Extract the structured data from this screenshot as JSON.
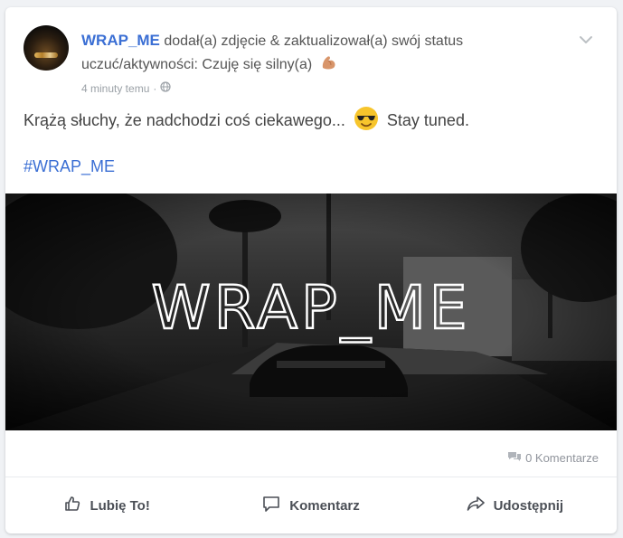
{
  "post": {
    "author": "WRAP_ME",
    "action_text": "dodał(a) zdjęcie & zaktualizował(a) swój status uczuć/aktywności: Czuję się silny(a)",
    "time": "4 minuty temu",
    "meta_separator": "·",
    "text_before": "Krążą słuchy, że nadchodzi coś ciekawego...",
    "text_after": "Stay tuned.",
    "hashtag": "#WRAP_ME",
    "image_text": "WRAP_ME",
    "comments": "0 Komentarze"
  },
  "actions": {
    "like": "Lubię To!",
    "comment": "Komentarz",
    "share": "Udostępnij"
  },
  "icons": {
    "feeling": "flexed-biceps-icon",
    "emoji": "sunglasses-emoji-icon",
    "privacy": "globe-icon",
    "menu": "chevron-down-icon",
    "comments": "comments-icon",
    "like": "thumbs-up-icon",
    "comment": "comment-icon",
    "share": "share-icon"
  },
  "colors": {
    "link": "#3b6fd4",
    "muted": "#9aa0a6",
    "action": "#4b4f56"
  }
}
